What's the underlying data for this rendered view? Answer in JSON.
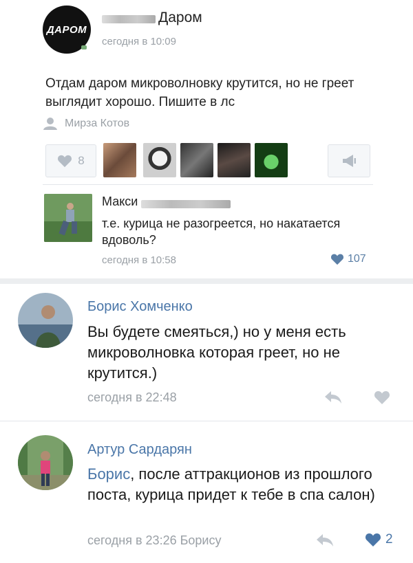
{
  "post": {
    "logo_text": "ДАРОМ",
    "group_name": "Даром",
    "time": "сегодня в 10:09",
    "text": "Отдам даром микроволновку крутится, но не греет выглядит хорошо. Пишите в лс",
    "author": "Мирза Котов",
    "likes_count": "8"
  },
  "top_comment": {
    "name": "Макси",
    "text": "т.е. курица не разогреется, но накатается вдоволь?",
    "time": "сегодня в 10:58",
    "likes": "107"
  },
  "comments": [
    {
      "name": "Борис Хомченко",
      "text": "Вы будете смеяться,) но у меня есть микроволновка которая греет, но не крутится.)",
      "time": "сегодня в 22:48"
    },
    {
      "name": "Артур Сардарян",
      "mention": "Борис",
      "text": ", после аттракционов из прошлого поста, курица придет к тебе в спа салон)",
      "time": "сегодня в 23:26 Борису",
      "likes": "2"
    }
  ],
  "colors": {
    "link": "#4a76a8",
    "muted": "#9aa0a6",
    "accent": "#5b7fa6"
  }
}
